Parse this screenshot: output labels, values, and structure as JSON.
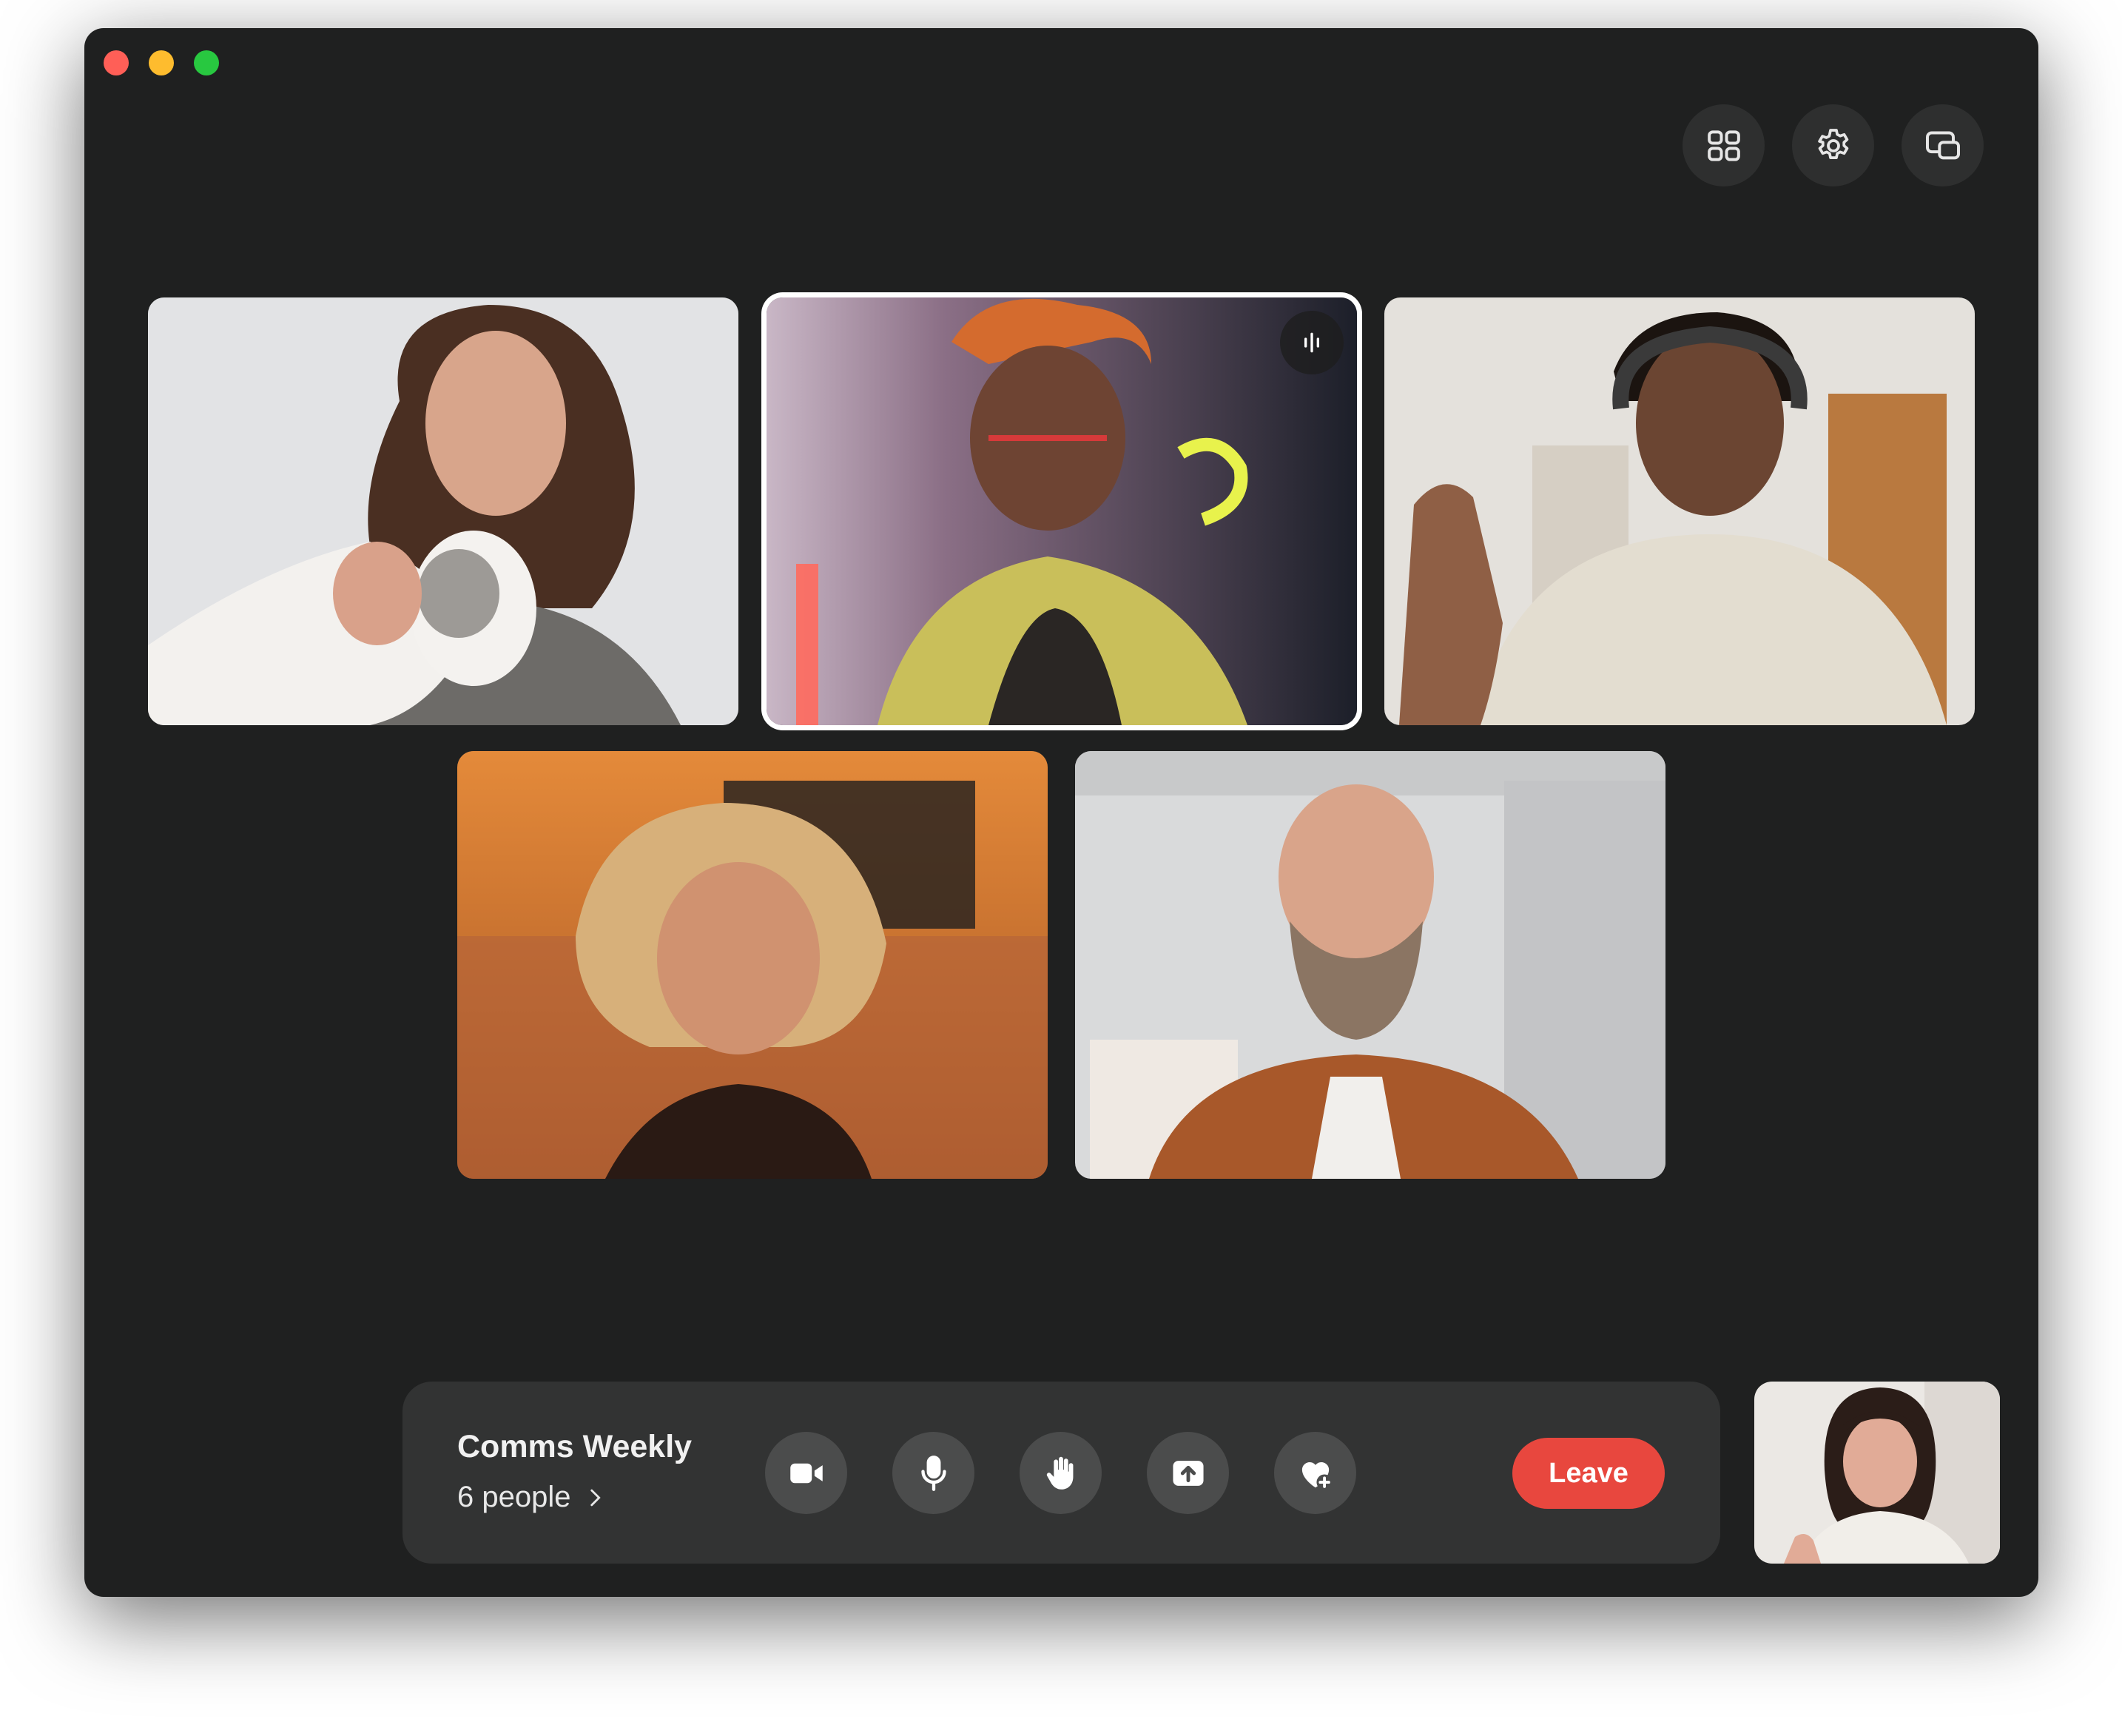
{
  "window": {
    "traffic_lights": [
      "close",
      "minimize",
      "maximize"
    ]
  },
  "toolbar": {
    "buttons": [
      {
        "name": "grid-layout",
        "icon": "grid-icon"
      },
      {
        "name": "settings",
        "icon": "gear-icon"
      },
      {
        "name": "picture-in-picture",
        "icon": "pip-icon"
      }
    ]
  },
  "participants": [
    {
      "tile": "participant-1",
      "description_icon": "video-feed",
      "speaking": false
    },
    {
      "tile": "participant-2",
      "description_icon": "video-feed",
      "speaking": true,
      "badge_icon": "audio-waveform-icon"
    },
    {
      "tile": "participant-3",
      "description_icon": "video-feed",
      "speaking": false
    },
    {
      "tile": "participant-4",
      "description_icon": "video-feed",
      "speaking": false
    },
    {
      "tile": "participant-5",
      "description_icon": "video-feed",
      "speaking": false
    }
  ],
  "call": {
    "title": "Comms Weekly",
    "people": "6 people",
    "leave_label": "Leave"
  },
  "controls": [
    {
      "name": "camera",
      "icon": "video-camera-icon"
    },
    {
      "name": "microphone",
      "icon": "microphone-icon"
    },
    {
      "name": "raise-hand",
      "icon": "hand-icon"
    },
    {
      "name": "share-screen",
      "icon": "share-upload-icon"
    },
    {
      "name": "react",
      "icon": "heart-plus-icon"
    }
  ],
  "colors": {
    "window_bg": "#1f2020",
    "bar_bg": "#323333",
    "button_bg": "#4b4c4c",
    "leave": "#e8473e",
    "active_border": "#ffffff"
  }
}
